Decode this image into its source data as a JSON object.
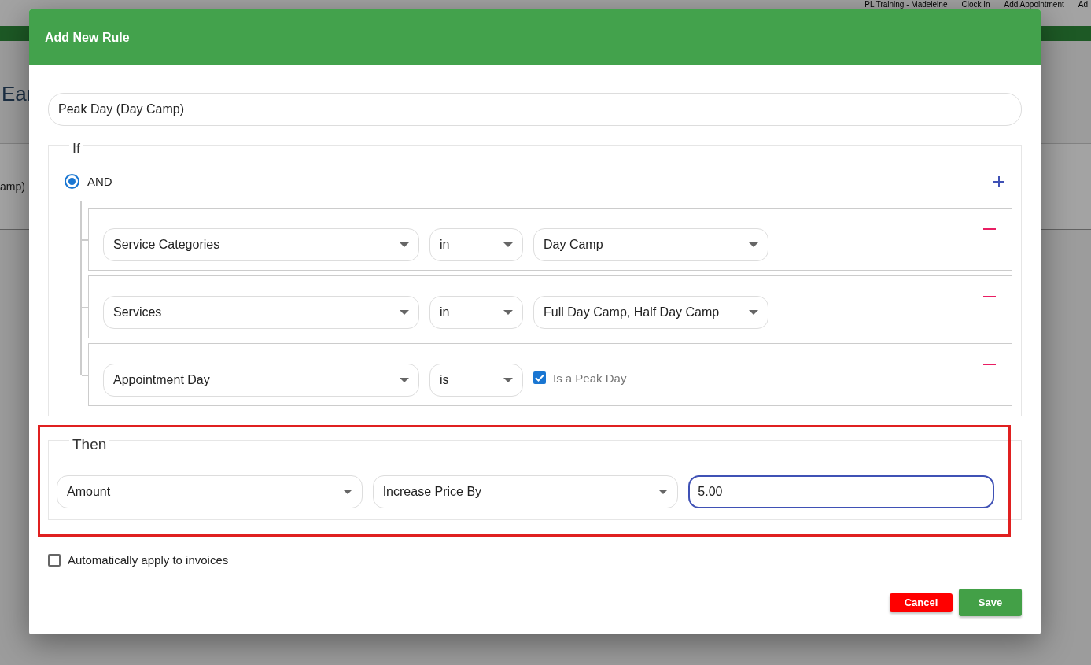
{
  "background": {
    "header_items": [
      "PL Training - Madeleine",
      "Clock In",
      "Add Appointment",
      "Ad"
    ],
    "heading": "Ear",
    "row_text": "amp)"
  },
  "dialog": {
    "title": "Add New Rule",
    "name_field": {
      "value": "Peak Day (Day Camp)"
    },
    "if_section": {
      "legend": "If",
      "operator": {
        "label": "AND",
        "selected": true
      },
      "conditions": [
        {
          "field": "Service Categories",
          "operator": "in",
          "kind": "select",
          "value": "Day Camp"
        },
        {
          "field": "Services",
          "operator": "in",
          "kind": "select",
          "value": "Full Day Camp, Half Day Camp"
        },
        {
          "field": "Appointment Day",
          "operator": "is",
          "kind": "checkbox",
          "value": "Is a Peak Day",
          "checked": true
        }
      ]
    },
    "then_section": {
      "legend": "Then",
      "highlighted": true,
      "type": "Amount",
      "action": "Increase Price By",
      "amount": "5.00"
    },
    "auto_apply": {
      "label": "Automatically apply to invoices",
      "checked": false
    },
    "buttons": [
      {
        "label": "Cancel",
        "kind": "cancel"
      },
      {
        "label": "Save",
        "kind": "save"
      }
    ]
  }
}
